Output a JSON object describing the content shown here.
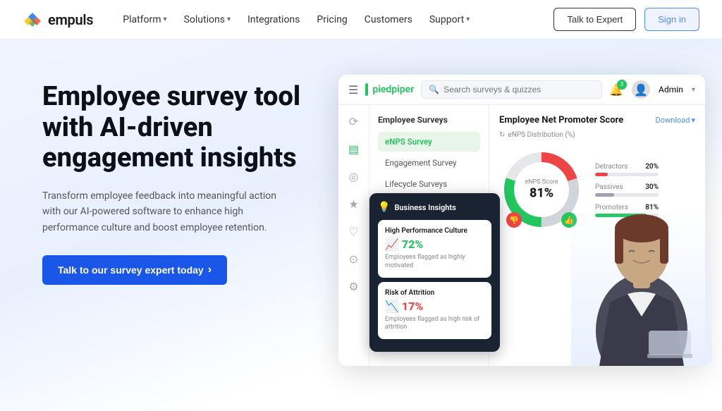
{
  "brand": {
    "logo_text": "empuls",
    "logo_icon": "✦"
  },
  "navbar": {
    "links": [
      {
        "label": "Platform",
        "has_dropdown": true
      },
      {
        "label": "Solutions",
        "has_dropdown": true
      },
      {
        "label": "Integrations",
        "has_dropdown": false
      },
      {
        "label": "Pricing",
        "has_dropdown": false
      },
      {
        "label": "Customers",
        "has_dropdown": false
      },
      {
        "label": "Support",
        "has_dropdown": true
      }
    ],
    "btn_talk": "Talk to Expert",
    "btn_signin": "Sign in"
  },
  "hero": {
    "title": "Employee survey tool with AI-driven engagement insights",
    "description": "Transform employee feedback into meaningful action with our AI-powered software to enhance high performance culture and boost employee retention.",
    "cta_label": "Talk to our survey expert today",
    "cta_arrow": "›"
  },
  "dashboard": {
    "brand_name": "pied",
    "brand_name2": "piper",
    "search_placeholder": "Search surveys & quizzes",
    "notif_count": "3",
    "admin_label": "Admin",
    "nav_icons": [
      "≡",
      "⊞",
      "◎",
      "★",
      "♥",
      "⊙",
      "⚙"
    ],
    "surveys": {
      "section_title": "Employee Surveys",
      "items": [
        {
          "label": "eNPS Survey",
          "active": true
        },
        {
          "label": "Engagement Survey",
          "active": false
        },
        {
          "label": "Lifecycle Surveys",
          "active": false
        }
      ]
    },
    "enps": {
      "title": "Employee Net Promoter Score",
      "download": "Download",
      "subtitle": "eNPS Distribution (%)",
      "score_label": "eNPS Score",
      "score_value": "81%",
      "legend": [
        {
          "label": "Detractors",
          "value": "20%",
          "color": "#ef4444",
          "pct": 20
        },
        {
          "label": "Passives",
          "value": "30%",
          "color": "#d1d5db",
          "pct": 30
        },
        {
          "label": "Promoters",
          "value": "81%",
          "color": "#22c55e",
          "pct": 81
        }
      ]
    },
    "business_insights": {
      "title": "Business Insights",
      "icon": "💡",
      "cards": [
        {
          "title": "High Performance Culture",
          "value": "72%",
          "trend": "up",
          "description": "Employees flagged as highly motivated"
        },
        {
          "title": "Risk of Attrition",
          "value": "17%",
          "trend": "down",
          "description": "Employees flagged as high risk of attrition"
        }
      ]
    }
  }
}
